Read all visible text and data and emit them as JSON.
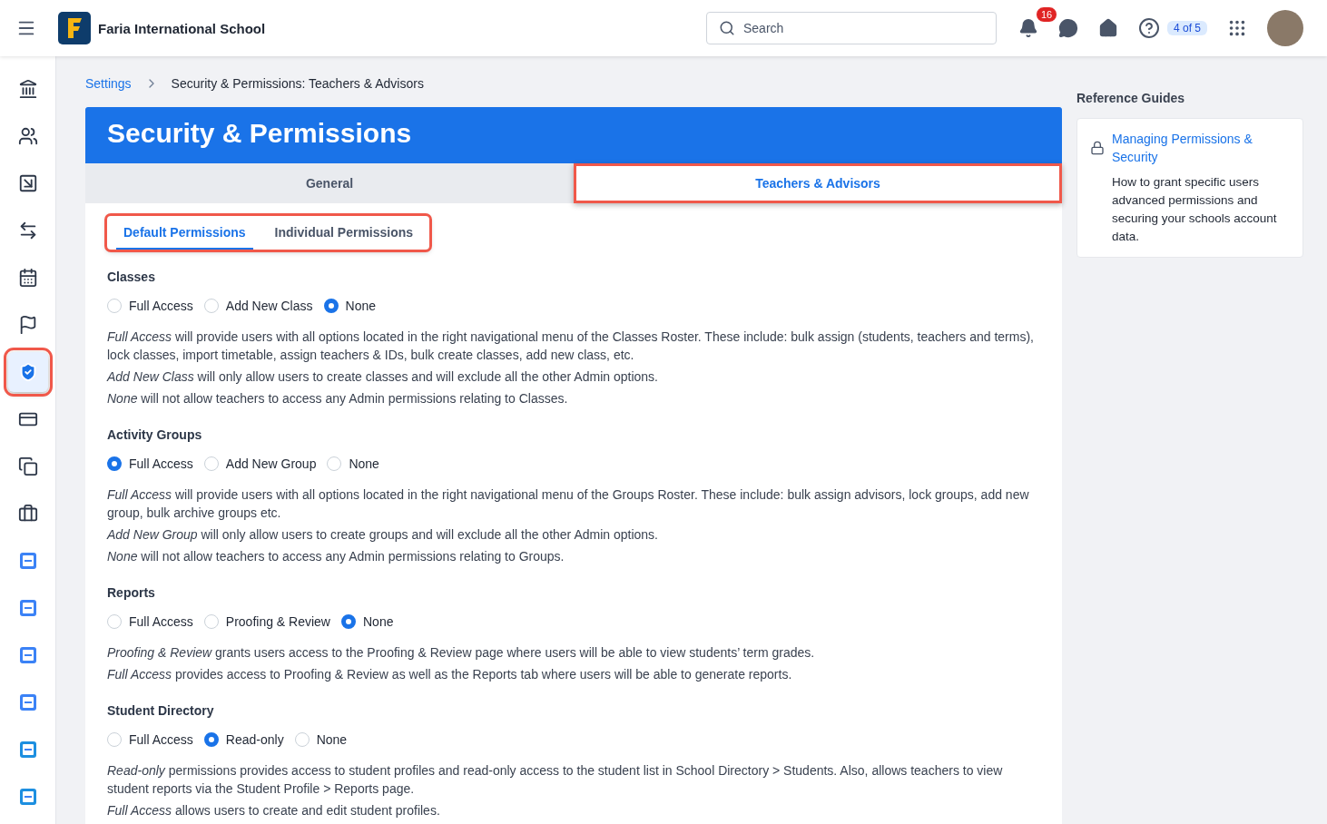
{
  "topbar": {
    "school": "Faria International School",
    "search": {
      "placeholder": "Search"
    },
    "notifications": "16",
    "help_progress": "4 of 5"
  },
  "sidebar": {
    "items": [
      {
        "selected": false,
        "highlighted": false
      },
      {
        "selected": false,
        "highlighted": false
      },
      {
        "selected": false,
        "highlighted": false
      },
      {
        "selected": false,
        "highlighted": false
      },
      {
        "selected": false,
        "highlighted": false
      },
      {
        "selected": false,
        "highlighted": false
      },
      {
        "selected": true,
        "highlighted": true
      },
      {
        "selected": false,
        "highlighted": false
      },
      {
        "selected": false,
        "highlighted": false
      },
      {
        "selected": false,
        "highlighted": false
      },
      {
        "selected": false,
        "highlighted": false
      },
      {
        "selected": false,
        "highlighted": false
      },
      {
        "selected": false,
        "highlighted": false
      },
      {
        "selected": false,
        "highlighted": false
      },
      {
        "selected": false,
        "highlighted": false
      },
      {
        "selected": false,
        "highlighted": false
      }
    ]
  },
  "breadcrumb": [
    "Settings",
    "Security & Permissions: Teachers & Advisors"
  ],
  "title": "Security & Permissions",
  "tabs": [
    {
      "label": "General",
      "selected": false,
      "highlighted": false
    },
    {
      "label": "Teachers & Advisors",
      "selected": true,
      "highlighted": true
    }
  ],
  "subtabs": {
    "highlighted": true,
    "items": [
      {
        "label": "Default Permissions",
        "selected": true
      },
      {
        "label": "Individual Permissions",
        "selected": false
      }
    ]
  },
  "sections": [
    {
      "title": "Classes",
      "options": [
        {
          "label": "Full Access",
          "selected": false
        },
        {
          "label": "Add New Class",
          "selected": false
        },
        {
          "label": "None",
          "selected": true
        }
      ],
      "notes": [
        "*Full Access* will provide users with all options located in the right navigational menu of the Classes Roster. These include: bulk assign (students, teachers and terms), lock classes, import timetable, assign teachers & IDs, bulk create classes, add new class, etc.",
        "*Add New Class* will only allow users to create classes and will exclude all the other Admin options.",
        "*None* will not allow teachers to access any Admin permissions relating to Classes."
      ]
    },
    {
      "title": "Activity Groups",
      "options": [
        {
          "label": "Full Access",
          "selected": true
        },
        {
          "label": "Add New Group",
          "selected": false
        },
        {
          "label": "None",
          "selected": false
        }
      ],
      "notes": [
        "*Full Access* will provide users with all options located in the right navigational menu of the Groups Roster. These include: bulk assign advisors, lock groups, add new group, bulk archive groups etc.",
        "*Add New Group* will only allow users to create groups and will exclude all the other Admin options.",
        "*None* will not allow teachers to access any Admin permissions relating to Groups."
      ]
    },
    {
      "title": "Reports",
      "options": [
        {
          "label": "Full Access",
          "selected": false
        },
        {
          "label": "Proofing & Review",
          "selected": false
        },
        {
          "label": "None",
          "selected": true
        }
      ],
      "notes": [
        "*Proofing & Review* grants users access to the Proofing & Review page where users will be able to view students’ term grades.",
        "*Full Access* provides access to Proofing & Review as well as the Reports tab where users will be able to generate reports."
      ]
    },
    {
      "title": "Student Directory",
      "options": [
        {
          "label": "Full Access",
          "selected": false
        },
        {
          "label": "Read-only",
          "selected": true
        },
        {
          "label": "None",
          "selected": false
        }
      ],
      "notes": [
        "*Read-only* permissions provides access to student profiles and read-only access to the student list in School Directory > Students. Also, allows teachers to view student reports via the Student Profile > Reports page.",
        "*Full Access* allows users to create and edit student profiles."
      ]
    }
  ],
  "reference": {
    "heading": "Reference Guides",
    "link": "Managing Permissions & Security",
    "description": "How to grant specific users advanced permissions and securing your schools account data."
  }
}
